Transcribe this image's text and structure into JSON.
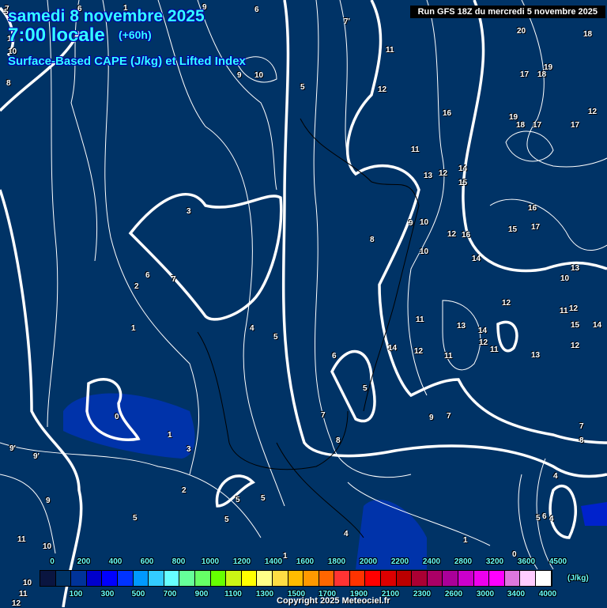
{
  "header": {
    "date": "samedi 8 novembre 2025",
    "time": "7:00 locale",
    "offset": "(+60h)",
    "parameter": "Surface-Based CAPE (J/kg) et Lifted Index",
    "run": "Run GFS 18Z du mercredi 5 novembre 2025"
  },
  "colors": {
    "background": "#003366",
    "title": "#33ffff",
    "contour": "#ffffff"
  },
  "legend": {
    "unit": "(J/kg)",
    "colors": [
      "#0a1540",
      "#003366",
      "#003399",
      "#0000cc",
      "#0000ff",
      "#0033ff",
      "#0099ff",
      "#33ccff",
      "#66ffff",
      "#66ff99",
      "#66ff66",
      "#66ff00",
      "#ccf515",
      "#ffff00",
      "#ffff88",
      "#ffdd44",
      "#ffbb00",
      "#ff9900",
      "#ff6600",
      "#ff3333",
      "#ff3300",
      "#ff0000",
      "#dd0000",
      "#bb0000",
      "#aa0033",
      "#aa0066",
      "#aa0099",
      "#cc00cc",
      "#ee00ee",
      "#ff00ff",
      "#dd77dd",
      "#ffccff",
      "#ffffff"
    ],
    "top_ticks": [
      "0",
      "200",
      "400",
      "600",
      "800",
      "1000",
      "1200",
      "1400",
      "1600",
      "1800",
      "2000",
      "2200",
      "2400",
      "2800",
      "3200",
      "3600",
      "4500"
    ],
    "bottom_ticks": [
      "100",
      "300",
      "500",
      "700",
      "900",
      "1100",
      "1300",
      "1500",
      "1700",
      "1900",
      "2100",
      "2300",
      "2600",
      "3000",
      "3400",
      "4000"
    ]
  },
  "contour_labels": [
    "6",
    "1",
    "9",
    "6",
    "7'",
    "20",
    "18",
    "11",
    "19",
    "17",
    "18",
    "12",
    "16",
    "12",
    "19",
    "18",
    "17",
    "17",
    "11",
    "13",
    "12",
    "14",
    "15",
    "3",
    "9",
    "10",
    "16",
    "17",
    "12",
    "16",
    "8",
    "15",
    "10",
    "14",
    "13",
    "10",
    "12",
    "2",
    "6",
    "7",
    "1",
    "4",
    "5",
    "11",
    "13",
    "14",
    "12",
    "11",
    "14",
    "12",
    "13",
    "15",
    "14",
    "12",
    "6",
    "5",
    "11",
    "12",
    "11",
    "3",
    "5",
    "7",
    "9",
    "7",
    "0",
    "1",
    "8",
    "7",
    "8",
    "9'",
    "9'",
    "2",
    "5",
    "5",
    "4",
    "1",
    "10",
    "9",
    "11",
    "10",
    "11",
    "12",
    "1",
    "0",
    "5",
    "4",
    "6",
    "4",
    "5",
    "1",
    "7",
    "5",
    "9",
    "10",
    "10",
    "8",
    "5"
  ],
  "copyright": "Copyright 2025 Meteociel.fr"
}
